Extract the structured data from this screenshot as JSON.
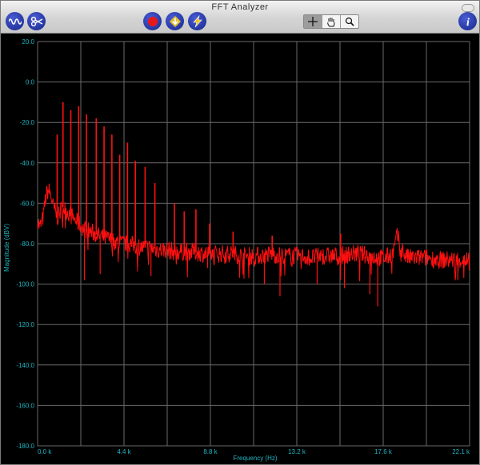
{
  "window": {
    "title": "FFT Analyzer"
  },
  "toolbar": {
    "left_buttons": [
      {
        "name": "waveform-button",
        "icon": "waveform-icon"
      },
      {
        "name": "scope-button",
        "icon": "scope-probe-icon"
      }
    ],
    "center_buttons": [
      {
        "name": "record-button",
        "icon": "record-icon"
      },
      {
        "name": "import-button",
        "icon": "download-arrow-icon"
      },
      {
        "name": "export-button",
        "icon": "lightning-icon"
      }
    ],
    "tools": [
      {
        "name": "crosshair-tool",
        "icon": "crosshair-icon",
        "active": true
      },
      {
        "name": "hand-tool",
        "icon": "hand-icon",
        "active": false
      },
      {
        "name": "zoom-tool",
        "icon": "magnifier-icon",
        "active": false
      }
    ],
    "info_button": {
      "icon": "info-icon"
    }
  },
  "colors": {
    "trace": "#ff1010",
    "axis_text": "#1fb5c2",
    "grid": "#6a6a6a",
    "background": "#000000"
  },
  "chart_data": {
    "type": "line",
    "title": "",
    "xlabel": "Frequency (Hz)",
    "ylabel": "Magnitude (dBV)",
    "xlim": [
      0,
      22.1
    ],
    "ylim": [
      -180,
      20
    ],
    "grid": true,
    "x_tick_labels": [
      "0.0 k",
      "4.4 k",
      "8.8 k",
      "13.2 k",
      "17.6 k",
      "22.1 k"
    ],
    "y_tick_labels": [
      "20.0",
      "0.0",
      "-20.0",
      "-40.0",
      "-60.0",
      "-80.0",
      "-100.0",
      "-120.0",
      "-140.0",
      "-160.0",
      "-180.0"
    ],
    "series": [
      {
        "color": "#ff1010",
        "x": [
          0.0,
          0.1,
          0.2,
          0.3,
          0.4,
          0.5,
          0.6,
          0.7,
          0.8,
          0.9,
          1.0,
          1.1,
          1.2,
          1.3,
          1.5,
          1.7,
          1.9,
          2.1,
          2.3,
          2.5,
          2.7,
          2.9,
          3.1,
          3.4,
          3.7,
          4.0,
          4.3,
          4.6,
          5.0,
          5.4,
          5.8,
          6.2,
          6.6,
          7.0,
          7.5,
          8.0,
          8.5,
          9.0,
          9.5,
          10.0,
          10.5,
          11.0,
          11.5,
          12.0,
          12.5,
          13.0,
          13.5,
          14.0,
          14.5,
          15.0,
          15.5,
          16.0,
          16.5,
          17.0,
          17.5,
          17.8,
          18.0,
          18.2,
          18.4,
          18.6,
          18.8,
          19.0,
          19.5,
          20.0,
          20.5,
          21.0,
          21.5,
          22.1
        ],
        "y": [
          -68,
          -72,
          -70,
          -66,
          -58,
          -54,
          -54,
          -57,
          -62,
          -64,
          -67,
          -66,
          -63,
          -62,
          -64,
          -66,
          -68,
          -70,
          -72,
          -73,
          -74,
          -75,
          -76,
          -77,
          -78,
          -79,
          -80,
          -80,
          -81,
          -82,
          -82,
          -83,
          -83,
          -84,
          -84,
          -84,
          -85,
          -85,
          -85,
          -85,
          -86,
          -86,
          -86,
          -85,
          -86,
          -86,
          -86,
          -87,
          -86,
          -86,
          -86,
          -85,
          -85,
          -86,
          -87,
          -87,
          -86,
          -84,
          -76,
          -82,
          -86,
          -87,
          -87,
          -87,
          -88,
          -88,
          -88,
          -88
        ]
      }
    ],
    "harmonic_peaks": [
      {
        "x": 1.0,
        "y": -26
      },
      {
        "x": 1.3,
        "y": -10
      },
      {
        "x": 1.7,
        "y": -14
      },
      {
        "x": 2.1,
        "y": -12
      },
      {
        "x": 2.5,
        "y": -16
      },
      {
        "x": 3.0,
        "y": -18
      },
      {
        "x": 3.4,
        "y": -22
      },
      {
        "x": 3.8,
        "y": -26
      },
      {
        "x": 4.2,
        "y": -36
      },
      {
        "x": 4.6,
        "y": -30
      },
      {
        "x": 5.0,
        "y": -39
      },
      {
        "x": 5.5,
        "y": -42
      },
      {
        "x": 6.0,
        "y": -50
      },
      {
        "x": 7.0,
        "y": -60
      },
      {
        "x": 7.5,
        "y": -64
      },
      {
        "x": 8.1,
        "y": -63
      },
      {
        "x": 8.8,
        "y": -70
      },
      {
        "x": 10.0,
        "y": -74
      },
      {
        "x": 12.0,
        "y": -76
      },
      {
        "x": 15.5,
        "y": -75
      }
    ],
    "dips": [
      {
        "x": 2.4,
        "y": -98
      },
      {
        "x": 3.2,
        "y": -95
      },
      {
        "x": 5.8,
        "y": -96
      },
      {
        "x": 8.7,
        "y": -92
      },
      {
        "x": 11.6,
        "y": -100
      },
      {
        "x": 12.4,
        "y": -106
      },
      {
        "x": 14.3,
        "y": -100
      },
      {
        "x": 15.7,
        "y": -102
      },
      {
        "x": 17.0,
        "y": -105
      },
      {
        "x": 17.4,
        "y": -111
      },
      {
        "x": 21.5,
        "y": -98
      }
    ]
  }
}
